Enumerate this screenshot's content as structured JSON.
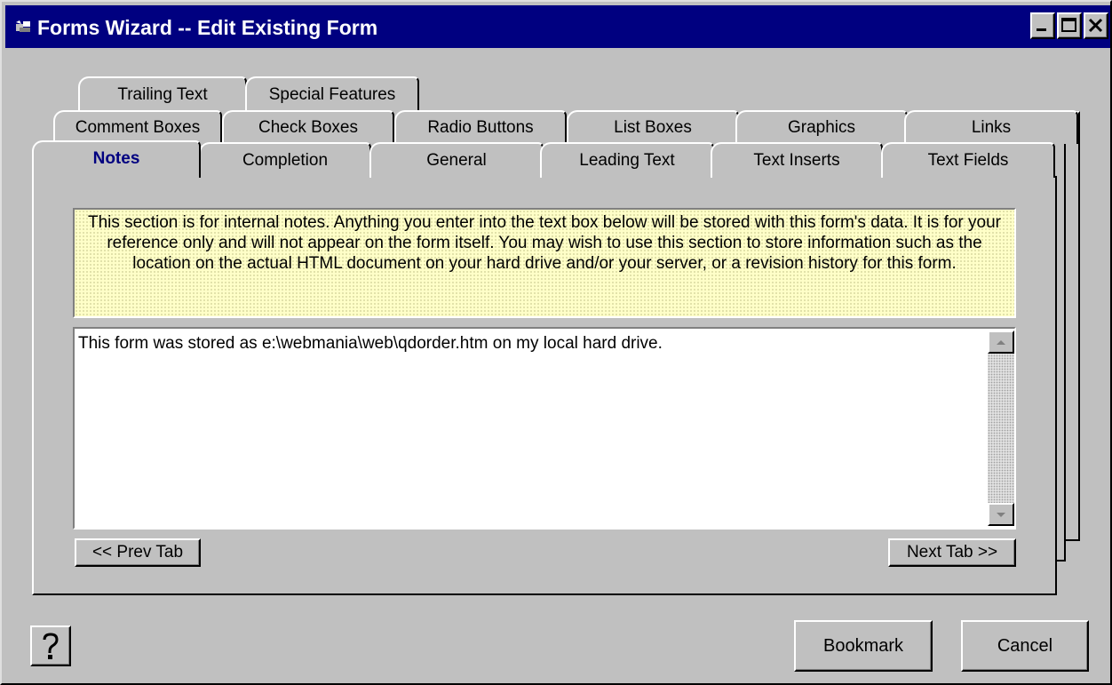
{
  "window": {
    "title": "Forms Wizard -- Edit Existing Form",
    "icons": [
      "app-icon",
      "minimize-icon",
      "maximize-icon",
      "close-icon"
    ]
  },
  "tabs": {
    "row1": [
      "Trailing Text",
      "Special Features"
    ],
    "row2": [
      "Comment Boxes",
      "Check Boxes",
      "Radio Buttons",
      "List Boxes",
      "Graphics",
      "Links"
    ],
    "row3": [
      "Notes",
      "Completion",
      "General",
      "Leading Text",
      "Text Inserts",
      "Text Fields"
    ],
    "active": "Notes"
  },
  "notes_page": {
    "info_text": "This section is for internal notes.  Anything you enter into the text box below will be stored with this form's data.  It is for your reference only and will not appear on the form itself.  You may wish to use this section to store information such as the location on the actual HTML document on your hard drive and/or your server, or a revision history for this form.",
    "notes_value": "This form was stored as e:\\webmania\\web\\qdorder.htm on my local hard drive.",
    "prev_label": "<< Prev Tab",
    "next_label": "Next Tab >>"
  },
  "footer": {
    "help_icon": "question-mark-icon",
    "bookmark_label": "Bookmark",
    "cancel_label": "Cancel"
  },
  "colors": {
    "titlebar": "#000080",
    "face": "#c0c0c0",
    "active_tab_text": "#000080",
    "info_background": "#ffffc8"
  }
}
